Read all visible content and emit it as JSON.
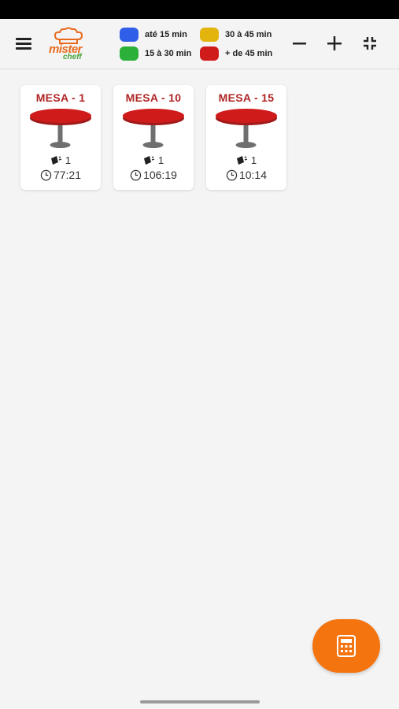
{
  "app": {
    "logo_line1": "mister",
    "logo_line2": "cheff"
  },
  "legend": [
    {
      "label": "até 15 min",
      "color": "#2f5fe8"
    },
    {
      "label": "30 à 45 min",
      "color": "#e3b40e"
    },
    {
      "label": "15 à 30 min",
      "color": "#2bb03a"
    },
    {
      "label": "+ de 45 min",
      "color": "#d01b1b"
    }
  ],
  "toolbar": {
    "zoom_out_icon": "minus-icon",
    "zoom_in_icon": "plus-icon",
    "collapse_icon": "collapse-icon"
  },
  "tables": [
    {
      "title": "MESA - 1",
      "orders": "1",
      "elapsed": "77:21"
    },
    {
      "title": "MESA - 10",
      "orders": "1",
      "elapsed": "106:19"
    },
    {
      "title": "MESA - 15",
      "orders": "1",
      "elapsed": "10:14"
    }
  ],
  "colors": {
    "accent": "#f47410",
    "table_red": "#d01b1b",
    "title_red": "#b02525"
  },
  "fab": {
    "icon": "calculator-icon"
  }
}
